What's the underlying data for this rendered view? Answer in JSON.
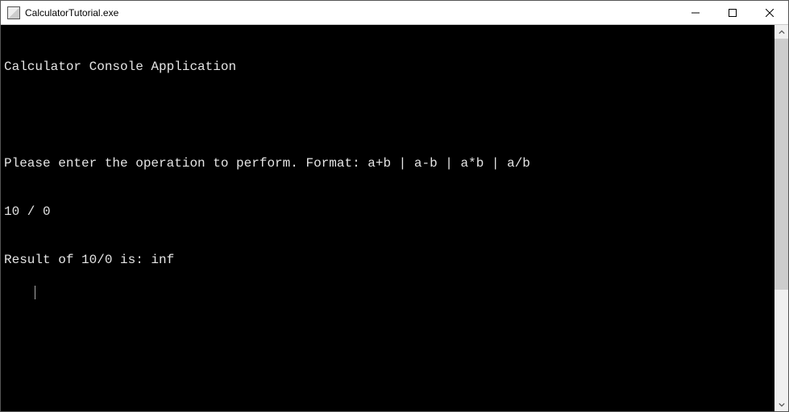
{
  "titlebar": {
    "title": "CalculatorTutorial.exe"
  },
  "console": {
    "lines": [
      "Calculator Console Application",
      "",
      "Please enter the operation to perform. Format: a+b | a-b | a*b | a/b",
      "10 / 0",
      "Result of 10/0 is: inf"
    ]
  }
}
